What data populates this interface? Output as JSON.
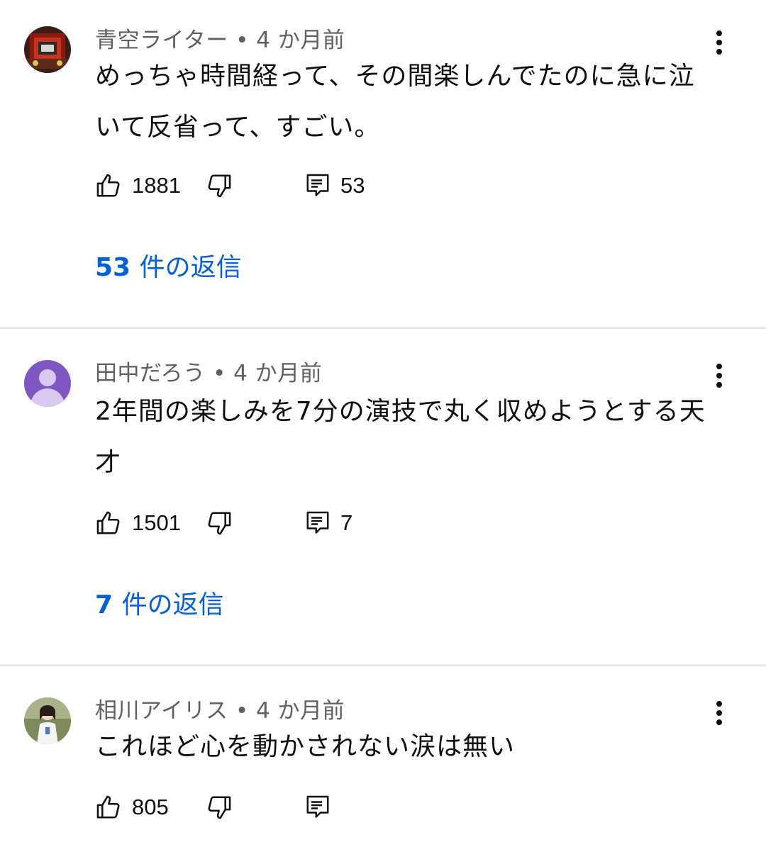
{
  "colors": {
    "link": "#065fd4",
    "meta": "#606060",
    "text": "#0f0f0f",
    "divider": "#e6e6e6"
  },
  "comments": [
    {
      "author": "青空ライター",
      "time": "4 か月前",
      "text_lines": [
        "めっちゃ時間経って、その間楽しんでたのに急に泣",
        "いて反省って、すごい。"
      ],
      "likes": "1881",
      "reply_count": "53",
      "replies_num": "53",
      "replies_word": "件の返信",
      "avatar_icon": "red-machine-photo"
    },
    {
      "author": "田中だろう",
      "time": "4 か月前",
      "text_lines": [
        "2年間の楽しみを7分の演技で丸く収めようとする天",
        "才"
      ],
      "likes": "1501",
      "reply_count": "7",
      "replies_num": "7",
      "replies_word": "件の返信",
      "avatar_icon": "default-person-avatar"
    },
    {
      "author": "相川アイリス",
      "time": "4 か月前",
      "text_lines": [
        "これほど心を動かされない涙は無い"
      ],
      "likes": "805",
      "reply_count": "",
      "avatar_icon": "girl-photo"
    }
  ],
  "icons": {
    "like": "thumbs-up-icon",
    "dislike": "thumbs-down-icon",
    "reply": "comment-icon",
    "menu": "more-vert-icon"
  }
}
